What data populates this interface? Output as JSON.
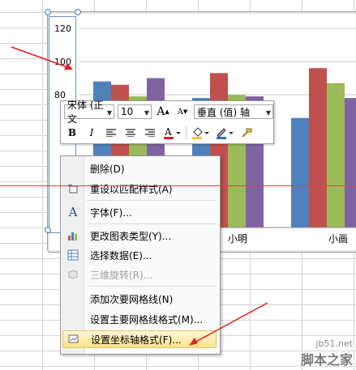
{
  "chart_data": {
    "type": "bar",
    "y_ticks": [
      "120",
      "100",
      "80"
    ],
    "ylim": [
      0,
      120
    ],
    "categories_visible": [
      "小明",
      "小画"
    ],
    "series": [
      {
        "color": "#4f81bd",
        "values": [
          88,
          78,
          66
        ]
      },
      {
        "color": "#c0504d",
        "values": [
          86,
          93,
          96
        ]
      },
      {
        "color": "#9bbb59",
        "values": [
          79,
          80,
          87
        ]
      },
      {
        "color": "#8064a2",
        "values": [
          90,
          79,
          78
        ]
      }
    ]
  },
  "mini_toolbar": {
    "font": "宋体 (正文",
    "size": "10",
    "grow": "A",
    "shrink": "A",
    "element": "垂直 (值) 轴",
    "bold": "B",
    "italic": "I"
  },
  "context_menu": {
    "items": [
      {
        "label": "删除(D)",
        "icon": "none",
        "disabled": false
      },
      {
        "label": "重设以匹配样式(A)",
        "icon": "reset-style-icon",
        "disabled": false
      },
      {
        "label": "字体(F)...",
        "icon": "font-icon",
        "disabled": false
      },
      {
        "label": "更改图表类型(Y)...",
        "icon": "chart-type-icon",
        "disabled": false
      },
      {
        "label": "选择数据(E)...",
        "icon": "select-data-icon",
        "disabled": false
      },
      {
        "label": "三维旋转(R)...",
        "icon": "rotate-3d-icon",
        "disabled": true
      },
      {
        "label": "添加次要网格线(N)",
        "icon": "none",
        "disabled": false
      },
      {
        "label": "设置主要网格线格式(M)...",
        "icon": "none",
        "disabled": false
      },
      {
        "label": "设置坐标轴格式(F)...",
        "icon": "format-axis-icon",
        "disabled": false,
        "highlighted": true
      }
    ]
  },
  "watermark": {
    "line1": "jb51.net",
    "line2": "脚本之家"
  },
  "colors": {
    "accent_arrow": "#e02020",
    "highlight": "#ffe38a"
  }
}
